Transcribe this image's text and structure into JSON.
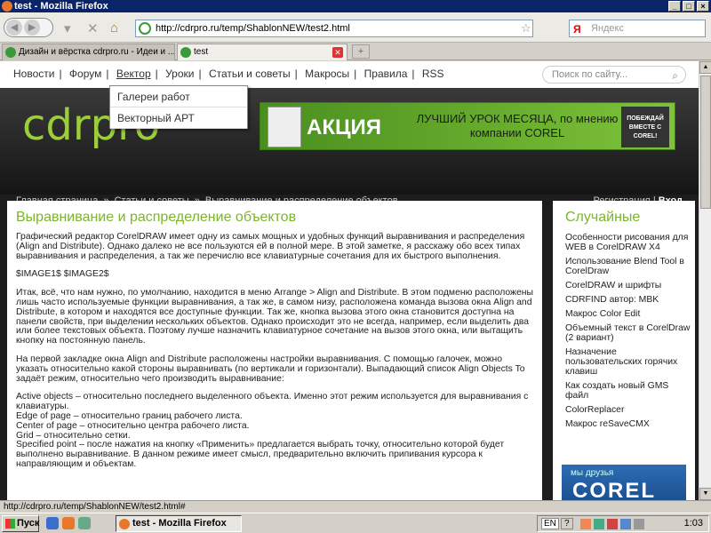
{
  "window": {
    "title": "test - Mozilla Firefox"
  },
  "browser": {
    "url": "http://cdrpro.ru/temp/ShablonNEW/test2.html",
    "search_placeholder": "Яндекс",
    "search_engine": "Я",
    "tabs": [
      {
        "label": "Дизайн и вёрстка cdrpro.ru - Идеи и ..."
      },
      {
        "label": "test"
      }
    ],
    "status_text": "http://cdrpro.ru/temp/ShablonNEW/test2.html#"
  },
  "site": {
    "nav": [
      "Новости",
      "Форум",
      "Вектор",
      "Уроки",
      "Статьи и советы",
      "Макросы",
      "Правила",
      "RSS"
    ],
    "search_placeholder": "Поиск по сайту...",
    "logo": "cdrpro",
    "dropdown": [
      "Галереи работ",
      "Векторный АРТ"
    ],
    "banner": {
      "akcia": "АКЦИЯ",
      "text": "ЛУЧШИЙ УРОК МЕСЯЦА, по мнению компании COREL",
      "badge": "ПОБЕЖДАЙ ВМЕСТЕ С COREL!"
    },
    "breadcrumbs": [
      "Главная страница",
      "Статьи и советы",
      "Выравнивание и распределение объектов"
    ],
    "breadcrumb_separator": "»",
    "register": "Регистрация",
    "login": "Вход",
    "article": {
      "title": "Выравнивание и распределение объектов",
      "paragraphs": [
        "Графический редактор CorelDRAW имеет одну из самых мощных и удобных функций выравнивания и распределения (Align and Distribute). Однако далеко не все пользуются ей в полной мере. В этой заметке, я расскажу обо всех типах выравнивания и распределения, а так же перечислю все клавиатурные сочетания для их быстрого выполнения.",
        "$IMAGE1$ $IMAGE2$",
        "Итак, всё, что нам нужно, по умолчанию, находится в меню Arrange > Align and Distribute. В этом подменю расположены лишь часто используемые функции выравнивания, а так же, в самом низу, расположена команда вызова окна Align and Distribute, в котором и находятся все доступные функции. Так же, кнопка вызова этого окна становится доступна на панели свойств, при выделении нескольких объектов. Однако происходит это не всегда, например, если выделить два или более текстовых объекта. Поэтому лучше назначить клавиатурное сочетание на вызов этого окна, или вытащить кнопку на постоянную панель.",
        "На первой закладке окна Align and Distribute расположены настройки выравнивания. С помощью галочек, можно указать относительно какой стороны выравнивать (по вертикали и горизонтали). Выпадающий список Align Objects To задаёт режим, относительно чего производить выравнивание:",
        "Active objects – относительно последнего выделенного объекта. Именно этот режим используется для выравнивания с клавиатуры.\nEdge of page – относительно границ рабочего листа.\nCenter of page – относительно центра рабочего листа.\nGrid – относительно сетки.\nSpecified point – после нажатия на кнопку «Применить» предлагается выбрать точку, относительно которой будет выполнено выравнивание. В данном режиме имеет смысл, предварительно включить припивания курсора к направляющим и объектам."
      ]
    },
    "sidebar": {
      "title": "Случайные",
      "items": [
        "Особенности рисования для WEB в CorelDRAW X4",
        "Использование Blend Tool в CorelDraw",
        "CorelDRAW и шрифты",
        "CDRFIND автор: MBK",
        "Макрос Color Edit",
        "Объемный текст в CorelDraw (2 вариант)",
        "Назначение пользовательских горячих клавиш",
        "Как создать новый GMS файл",
        "ColorReplacer",
        "Макрос reSaveCMX"
      ],
      "ad_line1": "мы друзья",
      "ad_line2": "COREL"
    }
  },
  "taskbar": {
    "start": "Пуск",
    "task": "test - Mozilla Firefox",
    "lang": "EN",
    "help": "?",
    "clock": "1:03"
  },
  "colors": {
    "accent": "#7bb52b",
    "header_bg": "#1d1d1d"
  }
}
